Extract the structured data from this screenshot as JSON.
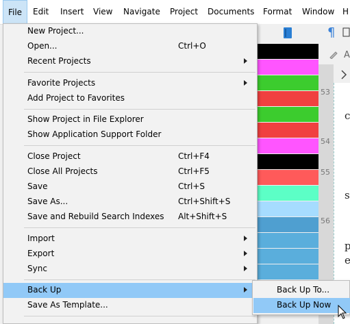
{
  "menubar": {
    "items": [
      {
        "label": "File"
      },
      {
        "label": "Edit"
      },
      {
        "label": "Insert"
      },
      {
        "label": "View"
      },
      {
        "label": "Navigate"
      },
      {
        "label": "Project"
      },
      {
        "label": "Documents"
      },
      {
        "label": "Format"
      },
      {
        "label": "Window"
      },
      {
        "label": "H"
      }
    ]
  },
  "file_menu": {
    "new_project": {
      "label": "New Project..."
    },
    "open": {
      "label": "Open...",
      "shortcut": "Ctrl+O"
    },
    "recent_projects": {
      "label": "Recent Projects"
    },
    "favorite_projects": {
      "label": "Favorite Projects"
    },
    "add_to_favorites": {
      "label": "Add Project to Favorites"
    },
    "show_in_explorer": {
      "label": "Show Project in File Explorer"
    },
    "show_support_folder": {
      "label": "Show Application Support Folder"
    },
    "close_project": {
      "label": "Close Project",
      "shortcut": "Ctrl+F4"
    },
    "close_all": {
      "label": "Close All Projects",
      "shortcut": "Ctrl+F5"
    },
    "save": {
      "label": "Save",
      "shortcut": "Ctrl+S"
    },
    "save_as": {
      "label": "Save As...",
      "shortcut": "Ctrl+Shift+S"
    },
    "save_rebuild": {
      "label": "Save and Rebuild Search Indexes",
      "shortcut": "Alt+Shift+S"
    },
    "import": {
      "label": "Import"
    },
    "export": {
      "label": "Export"
    },
    "sync": {
      "label": "Sync"
    },
    "back_up": {
      "label": "Back Up"
    },
    "save_as_template": {
      "label": "Save As Template..."
    }
  },
  "backup_submenu": {
    "back_up_to": {
      "label": "Back Up To..."
    },
    "back_up_now": {
      "label": "Back Up Now"
    }
  },
  "editor": {
    "line_numbers": [
      "53",
      "54",
      "55",
      "56"
    ],
    "page_letters": [
      "c",
      "s",
      "p",
      "e"
    ]
  },
  "colors": {
    "label_strips": [
      "#000000",
      "#ff55ff",
      "#3ccc2e",
      "#f04040",
      "#3ccc2e",
      "#f04040",
      "#ff55ff",
      "#000000",
      "#ff5a5a",
      "#5cffc6",
      "#a6dcff",
      "#4f9fd0",
      "#5aaedc",
      "#5aaedc",
      "#5aaedc",
      "#5aaedc",
      "#5aaedc"
    ],
    "highlight": "#91c9f7"
  }
}
